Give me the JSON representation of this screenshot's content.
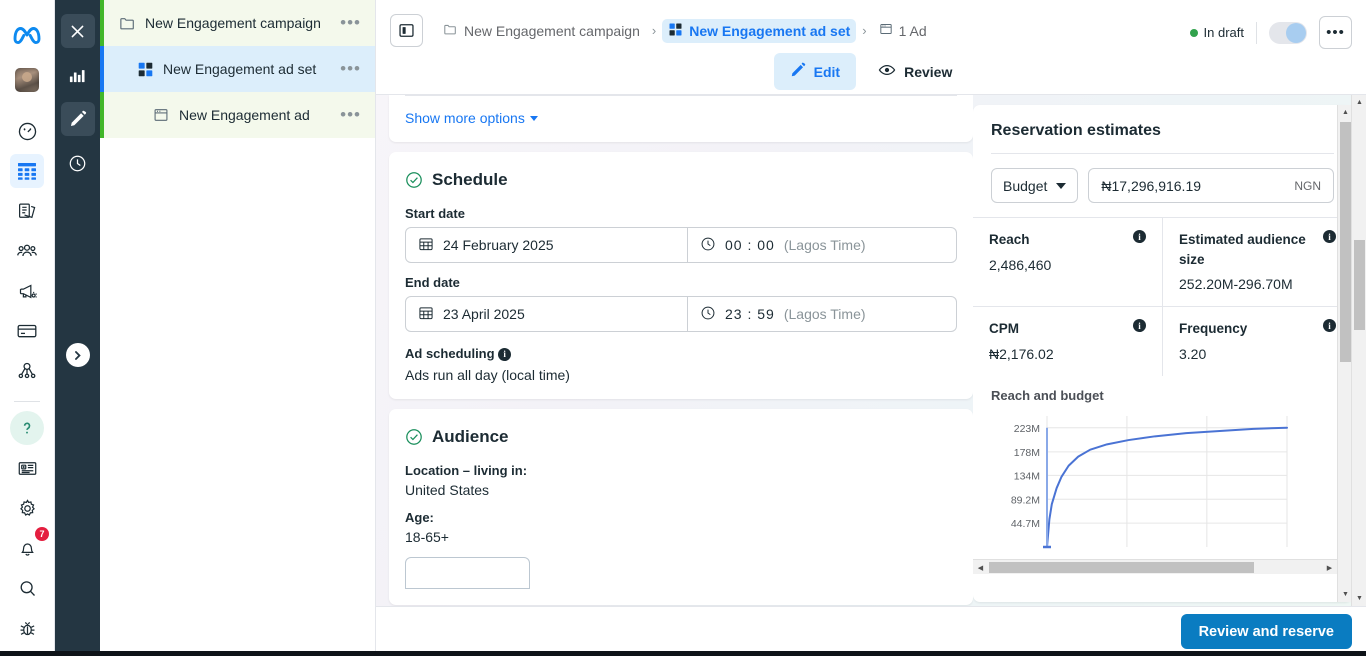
{
  "rail": {
    "logo_icon": "meta-logo",
    "avatar_icon": "user-avatar",
    "items": [
      {
        "icon": "speedometer-icon",
        "name": "performance",
        "active": false
      },
      {
        "icon": "table-grid-icon",
        "name": "campaigns",
        "active": true
      },
      {
        "icon": "documents-icon",
        "name": "library",
        "active": false
      },
      {
        "icon": "people-icon",
        "name": "audiences",
        "active": false
      },
      {
        "icon": "megaphone-icon",
        "name": "advertise",
        "active": false
      },
      {
        "icon": "credit-card-icon",
        "name": "billing",
        "active": false
      },
      {
        "icon": "share-node-icon",
        "name": "events",
        "active": false
      }
    ],
    "bottom_items": [
      {
        "icon": "help-question-icon",
        "name": "help",
        "badge": ""
      },
      {
        "icon": "news-icon",
        "name": "news",
        "badge": ""
      },
      {
        "icon": "gear-icon",
        "name": "settings",
        "badge": ""
      },
      {
        "icon": "bell-icon",
        "name": "notifications",
        "badge": "7"
      },
      {
        "icon": "search-icon",
        "name": "search",
        "badge": ""
      },
      {
        "icon": "bug-icon",
        "name": "report-bug",
        "badge": ""
      }
    ]
  },
  "darkstrip": {
    "buttons": [
      {
        "icon": "close-x-icon",
        "name": "close",
        "selected": false
      },
      {
        "icon": "bar-chart-icon",
        "name": "analytics",
        "selected": false
      },
      {
        "icon": "pencil-icon",
        "name": "edit",
        "selected": true
      },
      {
        "icon": "clock-icon",
        "name": "history",
        "selected": false
      }
    ],
    "expand_icon": "chevron-right-icon"
  },
  "tree": {
    "rows": [
      {
        "label": "New Engagement campaign",
        "icon": "folder-icon",
        "level": 0,
        "selected": false
      },
      {
        "label": "New Engagement ad set",
        "icon": "adset-icon",
        "level": 1,
        "selected": true
      },
      {
        "label": "New Engagement ad",
        "icon": "ad-card-icon",
        "level": 2,
        "selected": false
      }
    ],
    "overflow_glyph": "•••"
  },
  "topbar": {
    "panel_toggle_icon": "side-panel-icon",
    "breadcrumbs": [
      {
        "label": "New Engagement campaign",
        "icon": "folder-icon",
        "active": false
      },
      {
        "label": "New Engagement ad set",
        "icon": "adset-icon",
        "active": true
      },
      {
        "label": "1 Ad",
        "icon": "ad-card-icon",
        "active": false
      }
    ],
    "separator": "›",
    "status_label": "In draft",
    "status_color": "#31a24c",
    "toggle_on": true,
    "more_glyph": "•••",
    "tabs": [
      {
        "label": "Edit",
        "icon": "pencil-icon",
        "selected": true
      },
      {
        "label": "Review",
        "icon": "eye-icon",
        "selected": false
      }
    ]
  },
  "form": {
    "show_more_options": "Show more options",
    "schedule": {
      "title": "Schedule",
      "start_label": "Start date",
      "start_date": "24 February 2025",
      "start_time": "00 : 00",
      "start_tz": "(Lagos Time)",
      "end_label": "End date",
      "end_date": "23 April 2025",
      "end_time": "23 : 59",
      "end_tz": "(Lagos Time)",
      "ad_scheduling_label": "Ad scheduling",
      "ad_scheduling_value": "Ads run all day (local time)"
    },
    "audience": {
      "title": "Audience",
      "location_label": "Location – living in:",
      "location_value": "United States",
      "age_label": "Age:",
      "age_value": "18-65+"
    }
  },
  "estimates": {
    "title": "Reservation estimates",
    "budget_select": "Budget",
    "amount": "₦17,296,916.19",
    "currency": "NGN",
    "cells": [
      {
        "label": "Reach",
        "value": "2,486,460"
      },
      {
        "label": "Estimated audience size",
        "value": "252.20M-296.70M"
      },
      {
        "label": "CPM",
        "value": "₦2,176.02"
      },
      {
        "label": "Frequency",
        "value": "3.20"
      }
    ],
    "info_glyph": "i"
  },
  "chart_data": {
    "type": "line",
    "title": "Reach and budget",
    "xlabel": "",
    "ylabel": "",
    "ytick_labels": [
      "223M",
      "178M",
      "134M",
      "89.2M",
      "44.7M"
    ],
    "ytick_values": [
      223000000,
      178000000,
      134000000,
      89200000,
      44700000
    ],
    "ylim": [
      0,
      245000000
    ],
    "grid": true,
    "legend": "none",
    "line_color": "#4a73d4",
    "marker_color": "#8aa9e8",
    "series": [
      {
        "name": "Reach",
        "x": [
          0,
          1,
          2,
          4,
          6,
          9,
          13,
          18,
          25,
          34,
          45,
          58,
          72,
          86,
          100
        ],
        "y": [
          0,
          52,
          80,
          110,
          131,
          152,
          169,
          182,
          192,
          200,
          207,
          213,
          217,
          221,
          223
        ]
      }
    ],
    "marker_x": 0,
    "marker_note": "vertical budget marker at current budget"
  },
  "bottom": {
    "primary_button": "Review and reserve"
  }
}
